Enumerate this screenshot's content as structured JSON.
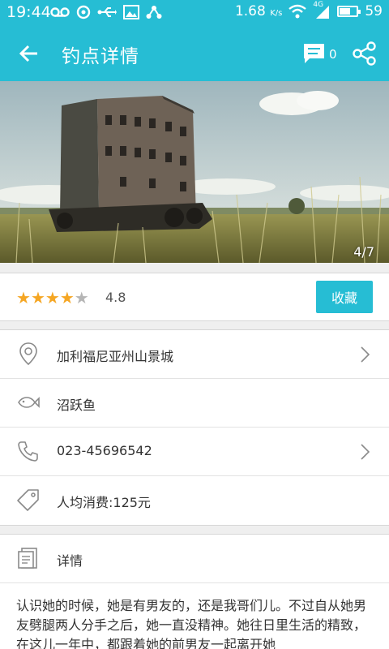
{
  "status_bar": {
    "time": "19:44",
    "speed": "1.68",
    "speed_unit": "K/s",
    "network": "4G",
    "battery": "59"
  },
  "appbar": {
    "title": "钓点详情",
    "comment_count": "0"
  },
  "hero": {
    "image_counter": "4/7"
  },
  "rating": {
    "stars_filled": 4,
    "stars_total": 5,
    "value": "4.8",
    "favorite_label": "收藏"
  },
  "info": {
    "address": "加利福尼亚州山景城",
    "fish": "沼跃鱼",
    "phone": "023-45696542",
    "cost": "人均消费:125元"
  },
  "detail": {
    "title": "详情",
    "body": "认识她的时候，她是有男友的，还是我哥们儿。不过自从她男友劈腿两人分手之后，她一直没精神。她往日里生活的精致，在这儿一年中，都跟着她的前男友一起离开她"
  },
  "colors": {
    "accent": "#26bdd4",
    "star_on": "#f5a623",
    "star_off": "#b5b5b5"
  }
}
